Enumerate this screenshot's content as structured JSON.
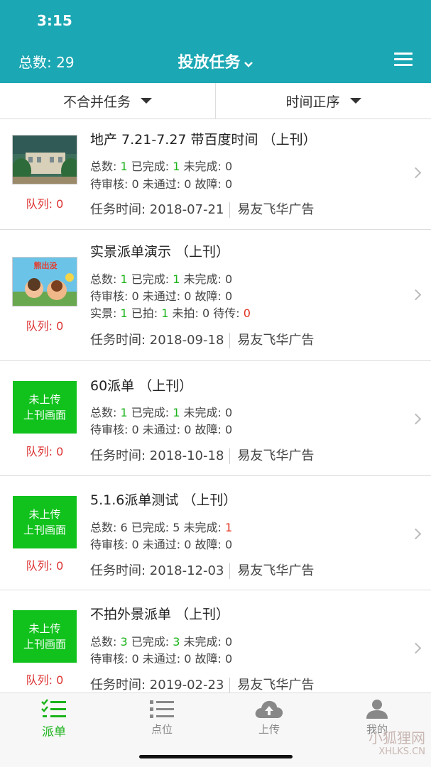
{
  "status": {
    "time": "3:15"
  },
  "header": {
    "total": "总数: 29",
    "title": "投放任务"
  },
  "filters": {
    "merge": "不合并任务",
    "sort": "时间正序"
  },
  "labels": {
    "total": "总数: ",
    "done": " 已完成: ",
    "undone": " 未完成: ",
    "pending": "待审核: ",
    "rejected": " 未通过: ",
    "fault": " 故障: ",
    "real": "实景: ",
    "shot": " 已拍: ",
    "unshot": " 未拍: ",
    "towait": " 待传: ",
    "task_time": "任务时间: "
  },
  "tasks": [
    {
      "title": "地产 7.21-7.27 带百度时间 （上刊）",
      "queue": "队列: 0",
      "total": "1",
      "done": "1",
      "undone": "0",
      "pending": "0",
      "rejected": "0",
      "fault": "0",
      "date": "2018-07-21",
      "company": "易友飞华广告"
    },
    {
      "title": "实景派单演示 （上刊）",
      "queue": "队列: 0",
      "total": "1",
      "done": "1",
      "undone": "0",
      "pending": "0",
      "rejected": "0",
      "fault": "0",
      "real": "1",
      "shot": "1",
      "unshot": "0",
      "towait": "0",
      "date": "2018-09-18",
      "company": "易友飞华广告"
    },
    {
      "title": "60派单 （上刊）",
      "queue": "队列: 0",
      "thumb_text": [
        "未上传",
        "上刊画面"
      ],
      "total": "1",
      "done": "1",
      "undone": "0",
      "pending": "0",
      "rejected": "0",
      "fault": "0",
      "date": "2018-10-18",
      "company": "易友飞华广告"
    },
    {
      "title": "5.1.6派单测试 （上刊）",
      "queue": "队列: 0",
      "thumb_text": [
        "未上传",
        "上刊画面"
      ],
      "total": "6",
      "done": "5",
      "undone": "1",
      "pending": "0",
      "rejected": "0",
      "fault": "0",
      "date": "2018-12-03",
      "company": "易友飞华广告"
    },
    {
      "title": "不拍外景派单 （上刊）",
      "queue": "队列: 0",
      "thumb_text": [
        "未上传",
        "上刊画面"
      ],
      "total": "3",
      "done": "3",
      "undone": "0",
      "pending": "0",
      "rejected": "0",
      "fault": "0",
      "date": "2019-02-23",
      "company": "易友飞华广告"
    }
  ],
  "tabs": [
    {
      "label": "派单",
      "icon": "task-list-icon",
      "active": true
    },
    {
      "label": "点位",
      "icon": "list-icon",
      "active": false
    },
    {
      "label": "上传",
      "icon": "cloud-upload-icon",
      "active": false
    },
    {
      "label": "我的",
      "icon": "user-icon",
      "active": false
    }
  ],
  "watermark": {
    "text": "小狐狸网",
    "sub": "XHLKS.CN"
  },
  "colors": {
    "header": "#1ba7b3",
    "green": "#11c21d",
    "red": "#e0301e"
  }
}
